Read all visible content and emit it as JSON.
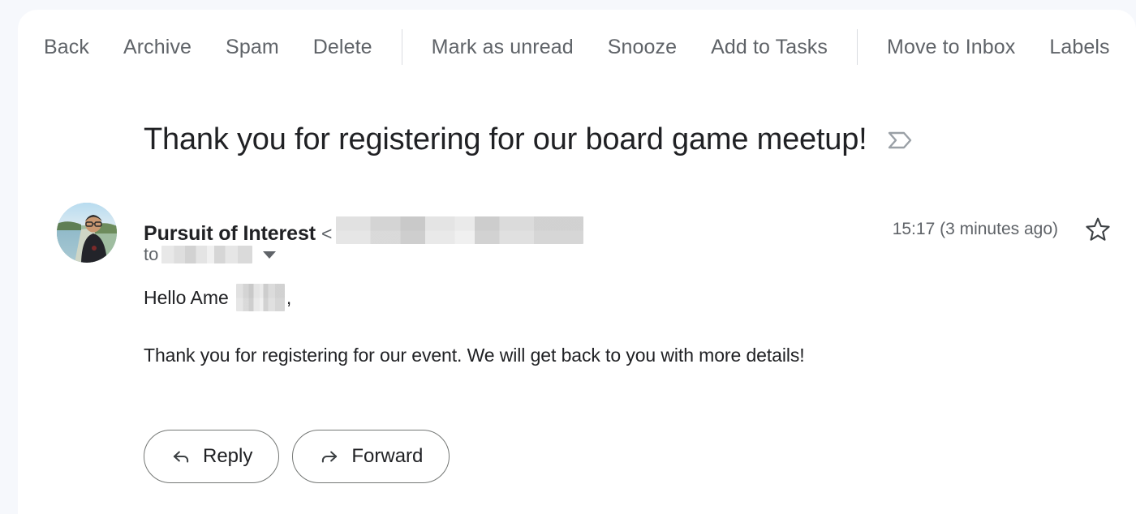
{
  "window": {
    "background_color": "#f6f8fc",
    "card_background": "#ffffff"
  },
  "toolbar": {
    "groups": [
      {
        "items": [
          {
            "label": "Back",
            "name": "toolbar-back"
          },
          {
            "label": "Archive",
            "name": "toolbar-archive"
          },
          {
            "label": "Spam",
            "name": "toolbar-spam"
          },
          {
            "label": "Delete",
            "name": "toolbar-delete"
          }
        ]
      },
      {
        "items": [
          {
            "label": "Mark as unread",
            "name": "toolbar-mark-as-unread"
          },
          {
            "label": "Snooze",
            "name": "toolbar-snooze"
          },
          {
            "label": "Add to Tasks",
            "name": "toolbar-add-to-tasks"
          }
        ]
      },
      {
        "items": [
          {
            "label": "Move to Inbox",
            "name": "toolbar-move-to-inbox"
          },
          {
            "label": "Labels",
            "name": "toolbar-labels"
          }
        ]
      }
    ],
    "text_color": "#5f6368",
    "divider_color": "#dadce0"
  },
  "email": {
    "subject": "Thank you for registering for our board game meetup!",
    "label_chip_icon": "label-chevron-icon",
    "sender": {
      "name": "Pursuit of Interest",
      "angle_open": "<",
      "address_redacted": true,
      "avatar_icon": "avatar-photo"
    },
    "recipient": {
      "prefix": "to",
      "address_redacted": true,
      "details_toggle_icon": "chevron-down-icon"
    },
    "timestamp": "15:17 (3 minutes ago)",
    "star_icon": "star-outline-icon",
    "body": {
      "greeting_prefix": "Hello Ame",
      "greeting_redacted": true,
      "greeting_suffix": ",",
      "paragraph": "Thank you for registering for our event. We will get back to you with more details!"
    },
    "actions": [
      {
        "label": "Reply",
        "icon": "reply-arrow-icon",
        "name": "reply-button"
      },
      {
        "label": "Forward",
        "icon": "forward-arrow-icon",
        "name": "forward-button"
      }
    ]
  }
}
